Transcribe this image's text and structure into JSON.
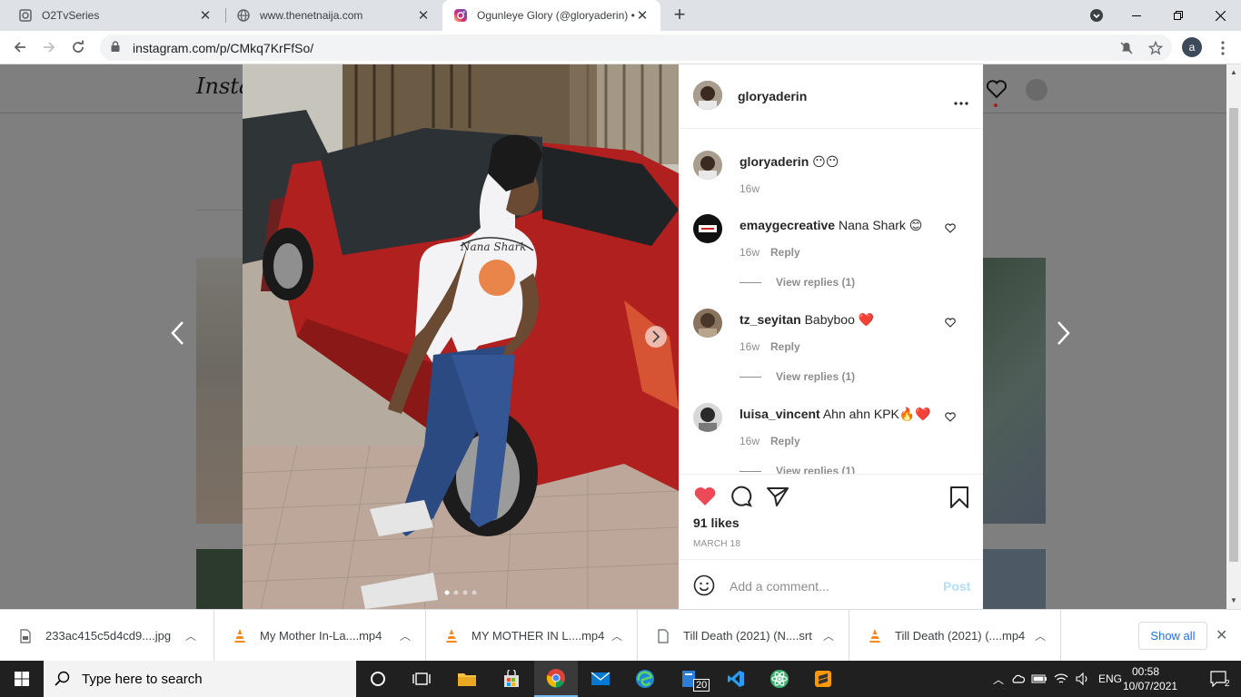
{
  "browser": {
    "tabs": [
      {
        "title": "O2TvSeries",
        "active": false
      },
      {
        "title": "www.thenetnaija.com",
        "active": false
      },
      {
        "title": "Ogunleye Glory (@gloryaderin) •",
        "active": true
      }
    ],
    "url": "instagram.com/p/CMkq7KrFfSo/",
    "profile_initial": "a"
  },
  "instagram": {
    "logo": "Insta",
    "post": {
      "author": "gloryaderin",
      "caption": {
        "user": "gloryaderin",
        "text": "😶😶",
        "time": "16w"
      },
      "comments": [
        {
          "user": "emaygecreative",
          "text": "Nana Shark 😊",
          "time": "16w",
          "reply": "Reply",
          "view_replies": "View replies (1)"
        },
        {
          "user": "tz_seyitan",
          "text": "Babyboo ❤️",
          "time": "16w",
          "reply": "Reply",
          "view_replies": "View replies (1)"
        },
        {
          "user": "luisa_vincent",
          "text": "Ahn ahn KPK🔥❤️",
          "time": "16w",
          "reply": "Reply",
          "view_replies": "View replies (1)"
        }
      ],
      "likes": "91 likes",
      "date": "MARCH 18",
      "comment_placeholder": "Add a comment...",
      "post_label": "Post",
      "shirt_text": "Nana Shark"
    }
  },
  "downloads": {
    "items": [
      {
        "name": "233ac415c5d4cd9....jpg",
        "icon": "image-file-icon"
      },
      {
        "name": "My Mother In-La....mp4",
        "icon": "vlc-icon"
      },
      {
        "name": "MY MOTHER IN L....mp4",
        "icon": "vlc-icon"
      },
      {
        "name": "Till Death (2021) (N....srt",
        "icon": "document-file-icon"
      },
      {
        "name": "Till Death (2021) (....mp4",
        "icon": "vlc-icon"
      }
    ],
    "show_all": "Show all"
  },
  "taskbar": {
    "search_placeholder": "Type here to search",
    "language": "ENG",
    "time": "00:58",
    "date": "10/07/2021",
    "notification_count": "2",
    "files_badge": "20"
  }
}
